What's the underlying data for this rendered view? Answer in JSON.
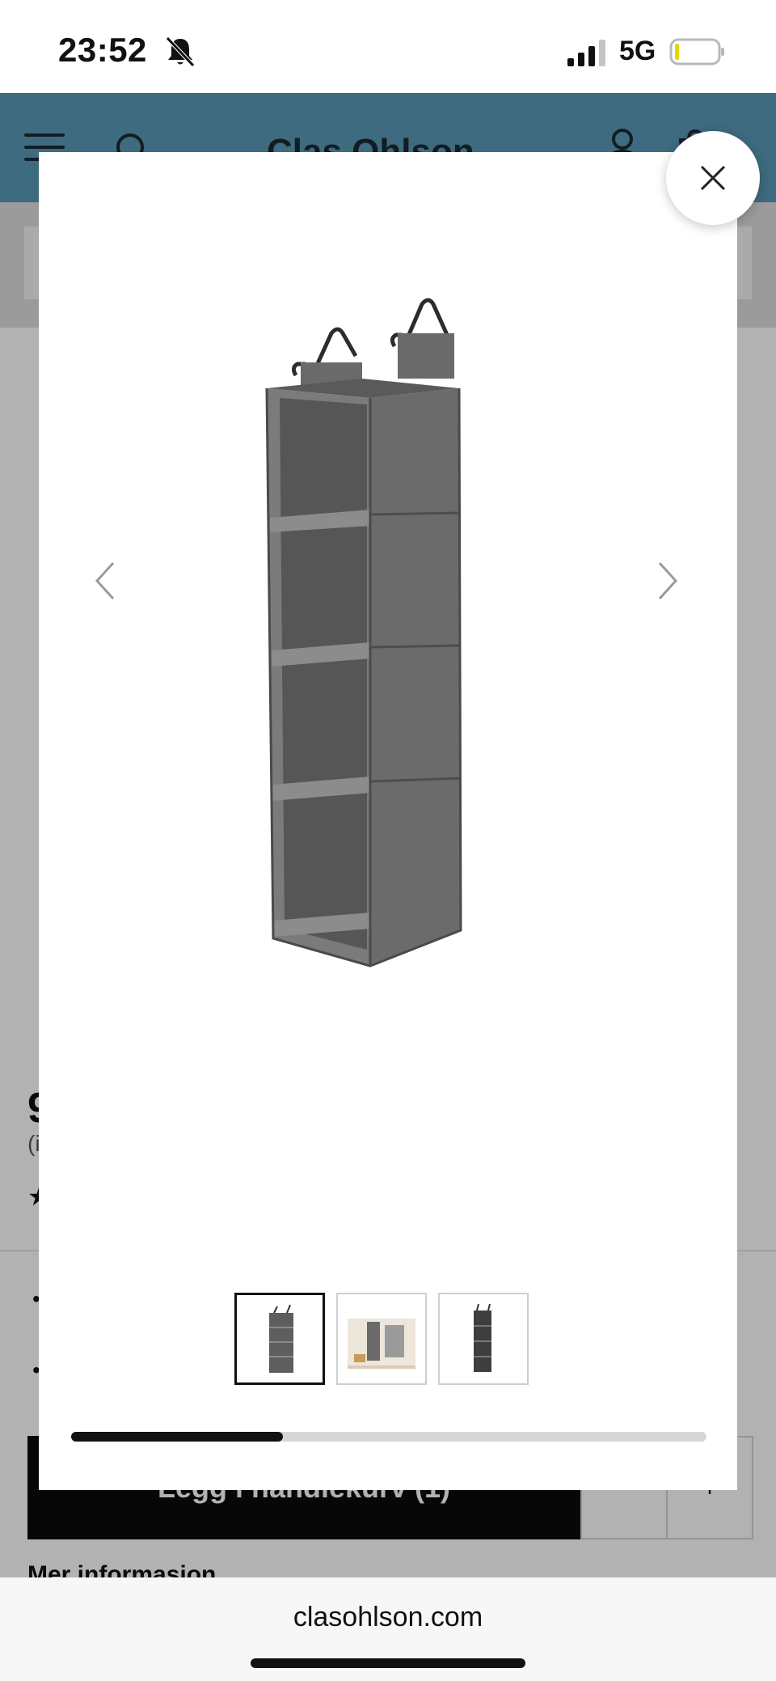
{
  "status_bar": {
    "time": "23:52",
    "network": "5G",
    "icons": [
      "bell-slash-icon",
      "signal-icon",
      "battery-icon"
    ]
  },
  "site": {
    "brand": "Clas Ohlson",
    "header_icons": [
      "menu-icon",
      "search-icon",
      "account-icon",
      "cart-icon"
    ],
    "header_color": "#5a9ab6"
  },
  "product_page": {
    "add_to_cart_label": "Legg i handlekurv (1)",
    "qty_minus": "-",
    "qty_plus": "+",
    "more_info": "Mer informasjon"
  },
  "gallery": {
    "close_icon": "close-icon",
    "prev_icon": "chevron-left-icon",
    "next_icon": "chevron-right-icon",
    "image_count": 3,
    "active_index": 1,
    "progress_fraction": 0.333
  },
  "url_bar": {
    "domain": "clasohlson.com"
  }
}
